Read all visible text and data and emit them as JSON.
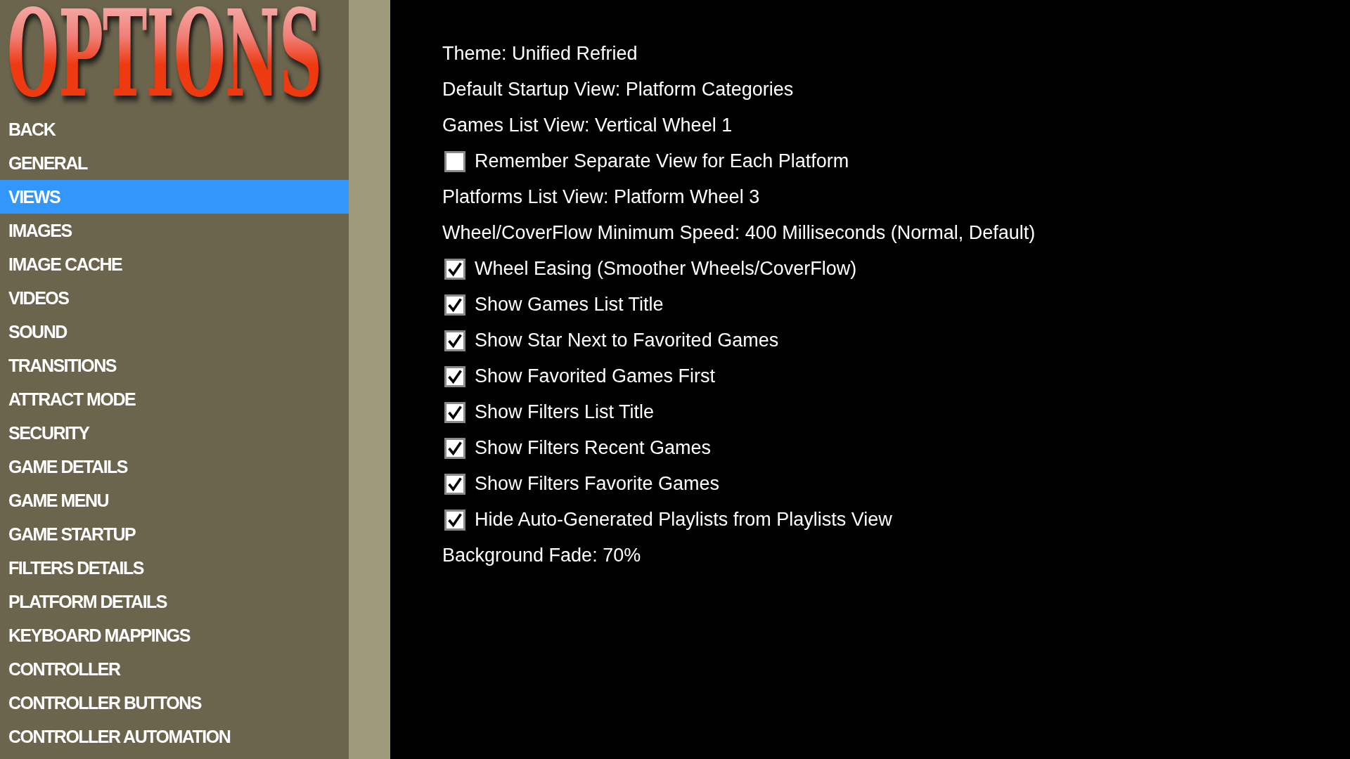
{
  "logo": {
    "title": "OPTIONS"
  },
  "sidebar": {
    "items": [
      {
        "label": "BACK",
        "selected": false
      },
      {
        "label": "GENERAL",
        "selected": false
      },
      {
        "label": "VIEWS",
        "selected": true
      },
      {
        "label": "IMAGES",
        "selected": false
      },
      {
        "label": "IMAGE CACHE",
        "selected": false
      },
      {
        "label": "VIDEOS",
        "selected": false
      },
      {
        "label": "SOUND",
        "selected": false
      },
      {
        "label": "TRANSITIONS",
        "selected": false
      },
      {
        "label": "ATTRACT MODE",
        "selected": false
      },
      {
        "label": "SECURITY",
        "selected": false
      },
      {
        "label": "GAME DETAILS",
        "selected": false
      },
      {
        "label": "GAME MENU",
        "selected": false
      },
      {
        "label": "GAME STARTUP",
        "selected": false
      },
      {
        "label": "FILTERS DETAILS",
        "selected": false
      },
      {
        "label": "PLATFORM DETAILS",
        "selected": false
      },
      {
        "label": "KEYBOARD MAPPINGS",
        "selected": false
      },
      {
        "label": "CONTROLLER",
        "selected": false
      },
      {
        "label": "CONTROLLER BUTTONS",
        "selected": false
      },
      {
        "label": "CONTROLLER AUTOMATION",
        "selected": false
      }
    ]
  },
  "settings": [
    {
      "kind": "text",
      "label": "Theme: Unified Refried"
    },
    {
      "kind": "text",
      "label": "Default Startup View: Platform Categories"
    },
    {
      "kind": "text",
      "label": "Games List View: Vertical Wheel 1"
    },
    {
      "kind": "checkbox",
      "label": "Remember Separate View for Each Platform",
      "checked": false
    },
    {
      "kind": "text",
      "label": "Platforms List View: Platform Wheel 3"
    },
    {
      "kind": "text",
      "label": "Wheel/CoverFlow Minimum Speed: 400 Milliseconds (Normal, Default)"
    },
    {
      "kind": "checkbox",
      "label": "Wheel Easing (Smoother Wheels/CoverFlow)",
      "checked": true
    },
    {
      "kind": "checkbox",
      "label": "Show Games List Title",
      "checked": true
    },
    {
      "kind": "checkbox",
      "label": "Show Star Next to Favorited Games",
      "checked": true
    },
    {
      "kind": "checkbox",
      "label": "Show Favorited Games First",
      "checked": true
    },
    {
      "kind": "checkbox",
      "label": "Show Filters List Title",
      "checked": true
    },
    {
      "kind": "checkbox",
      "label": "Show Filters Recent Games",
      "checked": true
    },
    {
      "kind": "checkbox",
      "label": "Show Filters Favorite Games",
      "checked": true
    },
    {
      "kind": "checkbox",
      "label": "Hide Auto-Generated Playlists from Playlists View",
      "checked": true
    },
    {
      "kind": "text",
      "label": "Background Fade: 70%"
    }
  ]
}
